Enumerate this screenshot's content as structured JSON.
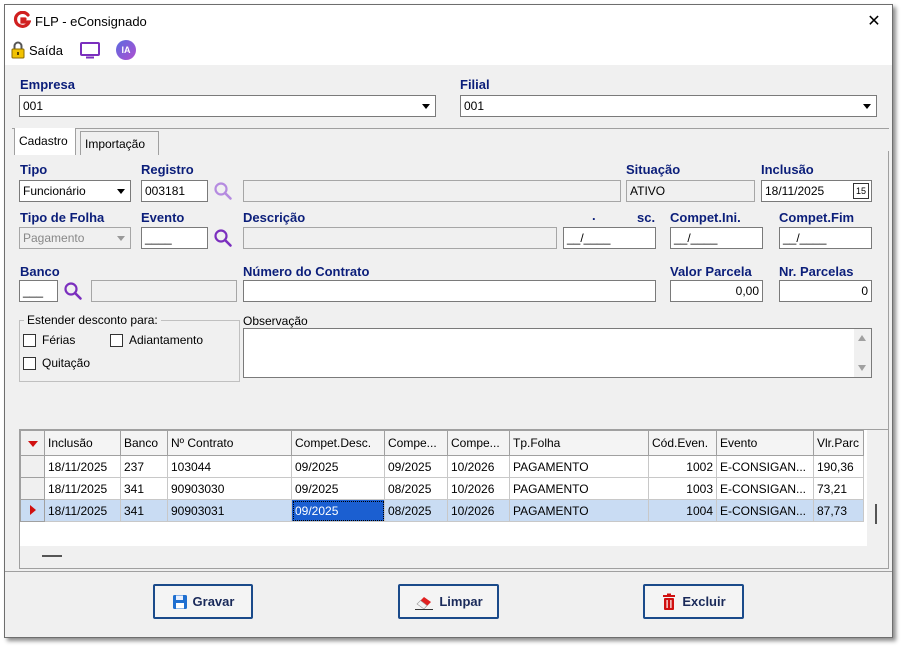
{
  "window": {
    "title": "FLP - eConsignado",
    "close_glyph": "✕",
    "logo_letter": "G",
    "logo_color": "#d02020"
  },
  "toolbar": {
    "exit_label": "Saída",
    "ia_label": "IA"
  },
  "empresa": {
    "label": "Empresa",
    "value": "001"
  },
  "filial": {
    "label": "Filial",
    "value": "001"
  },
  "tabs": [
    {
      "label": "Cadastro",
      "active": true
    },
    {
      "label": "Importação",
      "active": false
    }
  ],
  "form": {
    "tipo": {
      "label": "Tipo",
      "value": "Funcionário"
    },
    "registro": {
      "label": "Registro",
      "value": "003181",
      "name_value": ""
    },
    "situacao": {
      "label": "Situação",
      "value": "ATIVO"
    },
    "inclusao": {
      "label": "Inclusão",
      "value": "18/11/2025",
      "cal_label": "15"
    },
    "tipo_folha": {
      "label": "Tipo de Folha",
      "value": "Pagamento"
    },
    "evento": {
      "label": "Evento",
      "value": "____"
    },
    "descricao": {
      "label": "Descrição",
      "value": ""
    },
    "compet_desc": {
      "label": "sc.",
      "label_prefix": ".",
      "value": "__/____"
    },
    "compet_ini": {
      "label": "Compet.Ini.",
      "value": "__/____"
    },
    "compet_fim": {
      "label": "Compet.Fim",
      "value": "__/____"
    },
    "banco": {
      "label": "Banco",
      "value": "___",
      "name_value": ""
    },
    "numero_contrato": {
      "label": "Número do Contrato",
      "value": ""
    },
    "valor_parcela": {
      "label": "Valor Parcela",
      "value": "0,00"
    },
    "nr_parcelas": {
      "label": "Nr. Parcelas",
      "value": "0"
    },
    "estender": {
      "label": "Estender desconto para:",
      "ferias": "Férias",
      "adiantamento": "Adiantamento",
      "quitacao": "Quitação"
    },
    "observacao": {
      "label": "Observação",
      "value": ""
    }
  },
  "grid": {
    "columns": [
      "Inclusão",
      "Banco",
      "Nº Contrato",
      "Compet.Desc.",
      "Compe...",
      "Compe...",
      "Tp.Folha",
      "Cód.Even.",
      "Evento",
      "Vlr.Parc"
    ],
    "rows": [
      {
        "inclusao": "18/11/2025",
        "banco": "237",
        "contrato": "103044",
        "compet_desc": "09/2025",
        "compet_ini": "09/2025",
        "compet_fim": "10/2026",
        "tp_folha": "PAGAMENTO",
        "cod_even": "1002",
        "evento": "E-CONSIGAN...",
        "vlr_parc": "190,36"
      },
      {
        "inclusao": "18/11/2025",
        "banco": "341",
        "contrato": "90903030",
        "compet_desc": "09/2025",
        "compet_ini": "08/2025",
        "compet_fim": "10/2026",
        "tp_folha": "PAGAMENTO",
        "cod_even": "1003",
        "evento": "E-CONSIGAN...",
        "vlr_parc": "73,21"
      },
      {
        "inclusao": "18/11/2025",
        "banco": "341",
        "contrato": "90903031",
        "compet_desc": "09/2025",
        "compet_ini": "08/2025",
        "compet_fim": "10/2026",
        "tp_folha": "PAGAMENTO",
        "cod_even": "1004",
        "evento": "E-CONSIGAN...",
        "vlr_parc": "87,73"
      }
    ],
    "selected_row": 2
  },
  "buttons": {
    "save": "Gravar",
    "clear": "Limpar",
    "delete": "Excluir"
  },
  "colors": {
    "label_blue": "#0b1e7a",
    "selection": "#1b5fd1",
    "search_purple": "#7b2fbe"
  }
}
